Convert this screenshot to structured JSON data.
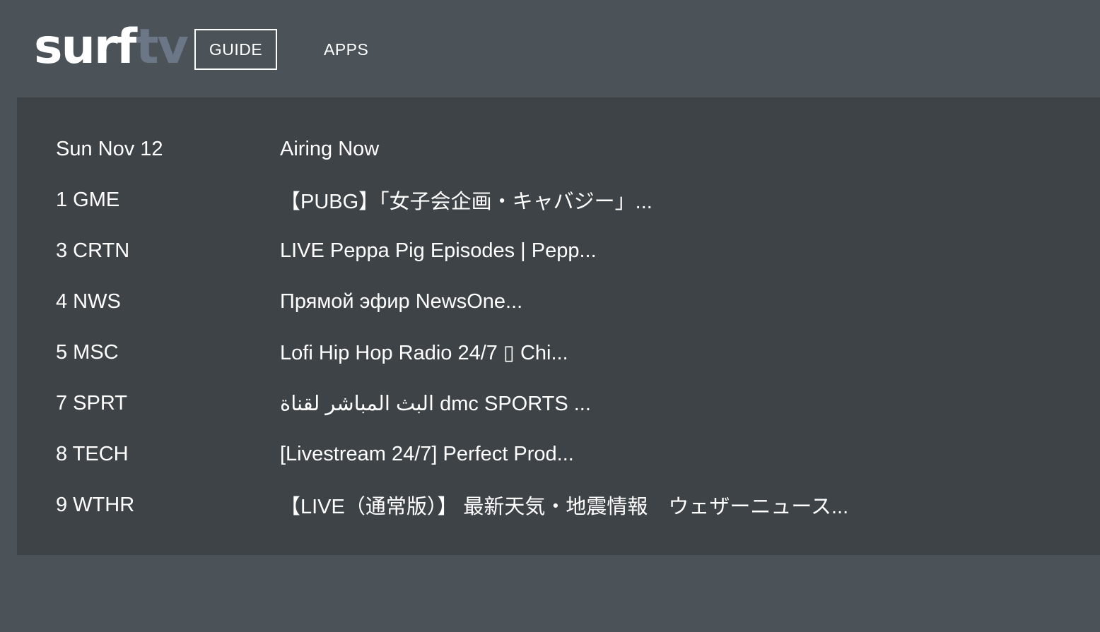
{
  "app": {
    "logo_main": "surf",
    "logo_accent": "tv"
  },
  "nav": {
    "guide_label": "GUIDE",
    "apps_label": "APPS"
  },
  "guide": {
    "date_header": "Sun Nov 12",
    "now_header": "Airing Now",
    "rows": [
      {
        "channel": "1 GME",
        "program": "【PUBG】「女子会企画・キャバジー」..."
      },
      {
        "channel": "3 CRTN",
        "program": "LIVE Peppa Pig Episodes | Pepp..."
      },
      {
        "channel": "4 NWS",
        "program": "Прямой эфир NewsOne..."
      },
      {
        "channel": "5 MSC",
        "program": "Lofi Hip Hop Radio 24/7 ▯ Chi..."
      },
      {
        "channel": "7 SPRT",
        "program": "البث المباشر لقناة dmc SPORTS ..."
      },
      {
        "channel": "8 TECH",
        "program": "[Livestream 24/7] Perfect Prod..."
      },
      {
        "channel": "9 WTHR",
        "program": "【LIVE（通常版）】 最新天気・地震情報　ウェザーニュース..."
      }
    ]
  }
}
